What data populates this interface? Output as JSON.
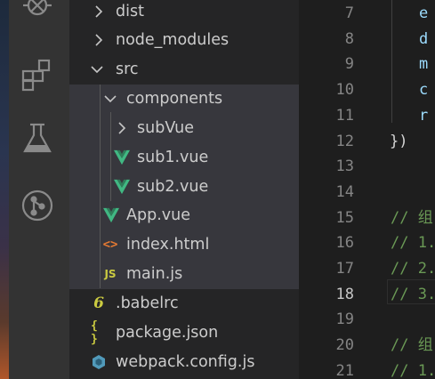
{
  "activity_bar": {
    "icons": [
      "debug-icon",
      "extensions-icon",
      "testing-icon",
      "source-control-icon"
    ]
  },
  "explorer": {
    "items": [
      {
        "label": "dist",
        "type": "folder",
        "expanded": false
      },
      {
        "label": "node_modules",
        "type": "folder",
        "expanded": false
      },
      {
        "label": "src",
        "type": "folder",
        "expanded": true
      },
      {
        "label": "components",
        "type": "folder",
        "expanded": true
      },
      {
        "label": "subVue",
        "type": "folder",
        "expanded": false
      },
      {
        "label": "sub1.vue",
        "type": "vue"
      },
      {
        "label": "sub2.vue",
        "type": "vue"
      },
      {
        "label": "App.vue",
        "type": "vue"
      },
      {
        "label": "index.html",
        "type": "html"
      },
      {
        "label": "main.js",
        "type": "js"
      },
      {
        "label": ".babelrc",
        "type": "babel"
      },
      {
        "label": "package.json",
        "type": "json"
      },
      {
        "label": "webpack.config.js",
        "type": "webpack"
      }
    ]
  },
  "icon_glyphs": {
    "js": "JS",
    "json": "{ }",
    "babel": "6",
    "html": "<>"
  },
  "editor": {
    "line_numbers": [
      "7",
      "8",
      "9",
      "10",
      "11",
      "12",
      "13",
      "14",
      "15",
      "16",
      "17",
      "18",
      "19",
      "20",
      "21"
    ],
    "active_line": "18",
    "lines": [
      {
        "text": "e",
        "color": "#9cdcfe"
      },
      {
        "text": "d",
        "color": "#9cdcfe"
      },
      {
        "text": "m",
        "color": "#9cdcfe"
      },
      {
        "text": "c",
        "color": "#9cdcfe"
      },
      {
        "text": "r",
        "color": "#9cdcfe"
      },
      {
        "text": "})",
        "color": "#d4d4d4"
      },
      {
        "text": "",
        "color": "#d4d4d4"
      },
      {
        "text": "",
        "color": "#d4d4d4"
      },
      {
        "text": "// 组",
        "color": "#6a9955"
      },
      {
        "text": "// 1.",
        "color": "#6a9955"
      },
      {
        "text": "// 2.",
        "color": "#6a9955"
      },
      {
        "text": "// 3.",
        "color": "#6a9955"
      },
      {
        "text": "",
        "color": "#d4d4d4"
      },
      {
        "text": "// 组",
        "color": "#6a9955"
      },
      {
        "text": "// 1.",
        "color": "#6a9955"
      }
    ]
  },
  "colors": {
    "vue": "#41b883",
    "js": "#cbcb41",
    "json": "#cbcb41",
    "babel": "#cbcb41",
    "html": "#e37933",
    "webpack": "#519aba"
  }
}
